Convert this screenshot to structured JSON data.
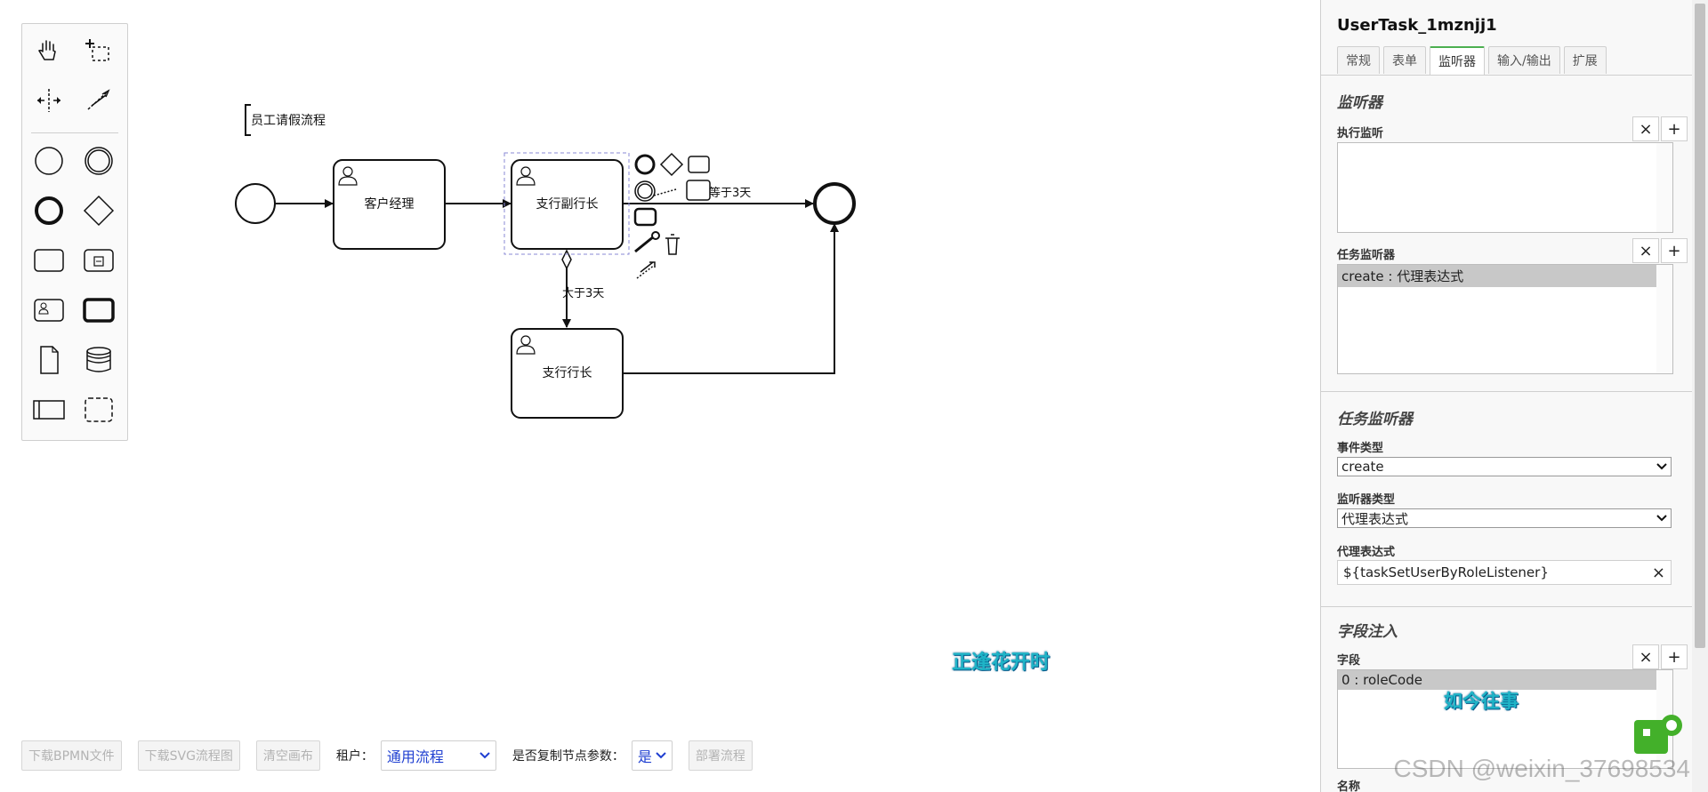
{
  "palette": {
    "tools": [
      "hand-tool-icon",
      "lasso-tool-icon",
      "space-tool-icon",
      "global-connect-icon"
    ],
    "shapes": [
      "start-event-icon",
      "intermediate-event-icon",
      "end-event-icon",
      "gateway-icon",
      "task-icon",
      "subprocess-icon",
      "user-task-icon",
      "call-activity-icon",
      "data-object-icon",
      "data-store-icon",
      "pool-icon",
      "group-icon"
    ]
  },
  "diagram": {
    "process_title": "员工请假流程",
    "tasks": [
      {
        "label": "客户经理"
      },
      {
        "label": "支行副行长"
      },
      {
        "label": "支行行长"
      }
    ],
    "flow_labels": {
      "equal": "等于3天",
      "greater": "大于3天"
    }
  },
  "watermarks": {
    "canvas": "正逢花开时",
    "panel": "如今往事",
    "csdn": "CSDN @weixin_37698534"
  },
  "toolbar": {
    "download_bpmn": "下载BPMN文件",
    "download_svg": "下载SVG流程图",
    "clear_canvas": "清空画布",
    "tenant_label": "租户：",
    "tenant_value": "通用流程",
    "copy_params_label": "是否复制节点参数：",
    "copy_params_value": "是",
    "deploy": "部署流程"
  },
  "panel": {
    "title": "UserTask_1mznjj1",
    "tabs": [
      {
        "label": "常规"
      },
      {
        "label": "表单"
      },
      {
        "label": "监听器",
        "active": true
      },
      {
        "label": "输入/输出"
      },
      {
        "label": "扩展"
      }
    ],
    "listeners_group": "监听器",
    "execution_listener_label": "执行监听",
    "task_listener_label": "任务监听器",
    "task_listener_selected": "create : 代理表达式",
    "task_listener_group": "任务监听器",
    "event_type_label": "事件类型",
    "event_type_value": "create",
    "listener_type_label": "监听器类型",
    "listener_type_value": "代理表达式",
    "delegate_expr_label": "代理表达式",
    "delegate_expr_value": "${taskSetUserByRoleListener}",
    "field_injection_group": "字段注入",
    "fields_label": "字段",
    "fields_selected": "0 : roleCode",
    "name_label": "名称",
    "clear_symbol": "×",
    "add_symbol": "+"
  },
  "colors": {
    "accent_tab": "#4caf50",
    "select_text": "#1f3fd1",
    "watermark": "#1fb4c7"
  }
}
